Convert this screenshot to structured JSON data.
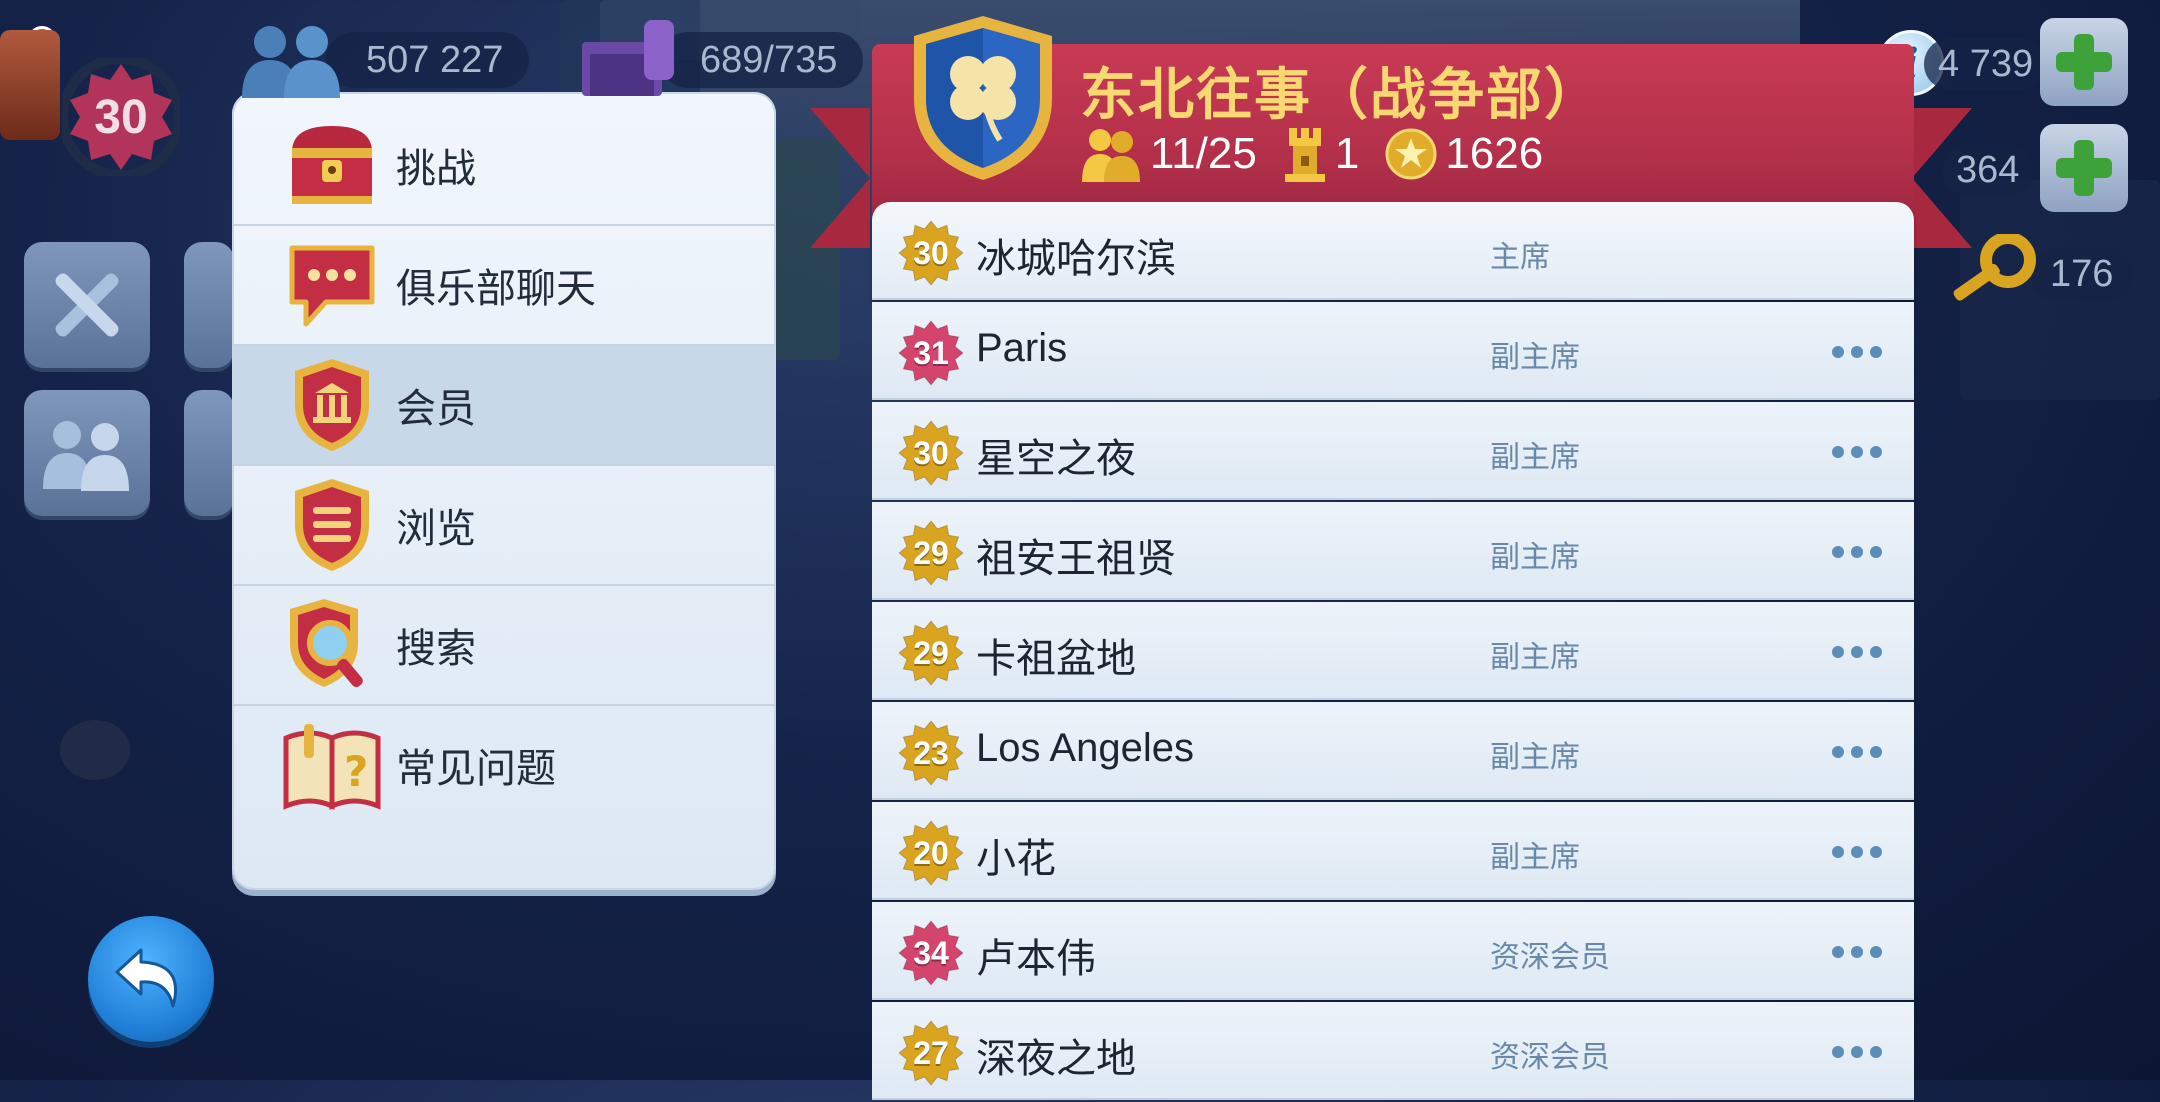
{
  "hud": {
    "level": "30",
    "population": "507 227",
    "storage": "689/735",
    "simcash": "4 739",
    "coins": "364",
    "keys": "176"
  },
  "menu": {
    "items": [
      {
        "label": "挑战",
        "icon": "treasure-chest-icon",
        "active": false
      },
      {
        "label": "俱乐部聊天",
        "icon": "chat-bubble-icon",
        "active": false
      },
      {
        "label": "会员",
        "icon": "members-shield-icon",
        "active": true
      },
      {
        "label": "浏览",
        "icon": "browse-shield-icon",
        "active": false
      },
      {
        "label": "搜索",
        "icon": "search-shield-icon",
        "active": false
      },
      {
        "label": "常见问题",
        "icon": "faq-book-icon",
        "active": false
      }
    ]
  },
  "club": {
    "name": "东北往事（战争部）",
    "members": "11/25",
    "rank": "1",
    "score": "1626"
  },
  "members": [
    {
      "level": "30",
      "name": "冰城哈尔滨",
      "role": "主席",
      "badge": "gold",
      "has_menu": false
    },
    {
      "level": "31",
      "name": "Paris",
      "role": "副主席",
      "badge": "pink",
      "has_menu": true
    },
    {
      "level": "30",
      "name": "星空之夜",
      "role": "副主席",
      "badge": "gold",
      "has_menu": true
    },
    {
      "level": "29",
      "name": "祖安王祖贤",
      "role": "副主席",
      "badge": "gold",
      "has_menu": true
    },
    {
      "level": "29",
      "name": "卡祖盆地",
      "role": "副主席",
      "badge": "gold",
      "has_menu": true
    },
    {
      "level": "23",
      "name": "Los Angeles",
      "role": "副主席",
      "badge": "gold",
      "has_menu": true
    },
    {
      "level": "20",
      "name": "小花",
      "role": "副主席",
      "badge": "gold",
      "has_menu": true
    },
    {
      "level": "34",
      "name": "卢本伟",
      "role": "资深会员",
      "badge": "pink",
      "has_menu": true
    },
    {
      "level": "27",
      "name": "深夜之地",
      "role": "资深会员",
      "badge": "gold",
      "has_menu": true
    }
  ],
  "colors": {
    "banner": "#b3304a",
    "club_name": "#f8d870",
    "gold_badge": "#d9a520",
    "pink_badge": "#d4456e",
    "role_text": "#6a89a9"
  }
}
